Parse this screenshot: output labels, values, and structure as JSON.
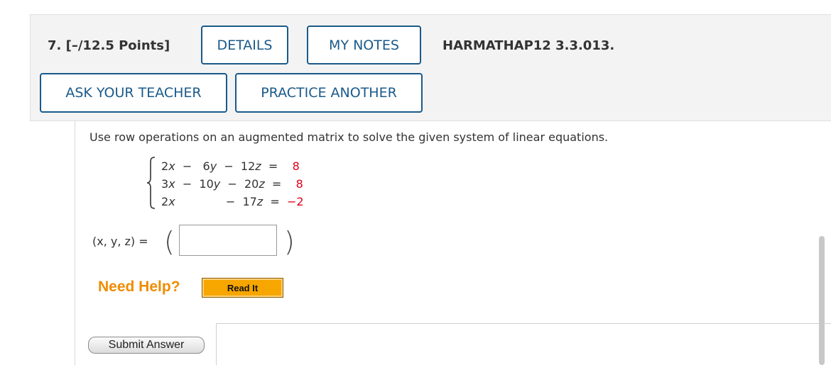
{
  "question": {
    "number_points": "7.  [–/12.5 Points]",
    "id": "HARMATHAP12 3.3.013."
  },
  "buttons": {
    "details": "DETAILS",
    "my_notes": "MY NOTES",
    "ask_teacher": "ASK YOUR TEACHER",
    "practice_another": "PRACTICE ANOTHER",
    "read_it": "Read It",
    "submit": "Submit Answer"
  },
  "problem": {
    "instructions": "Use row operations on an augmented matrix to solve the given system of linear equations.",
    "equations": [
      {
        "lhs_a": "2",
        "lhs_b": "6",
        "lhs_c": "12",
        "rhs": "8"
      },
      {
        "lhs_a": "3",
        "lhs_b": "10",
        "lhs_c": "20",
        "rhs": "8"
      },
      {
        "lhs_a": "2",
        "lhs_b": "",
        "lhs_c": "17",
        "rhs": "−2"
      }
    ],
    "answer_label": "(x, y, z) =",
    "answer_value": ""
  },
  "help": {
    "label": "Need Help?"
  },
  "colors": {
    "button_border": "#1a5a8a",
    "rhs_red": "#e0001b",
    "need_help_orange": "#f08c00",
    "read_it_bg": "#f7a600"
  }
}
